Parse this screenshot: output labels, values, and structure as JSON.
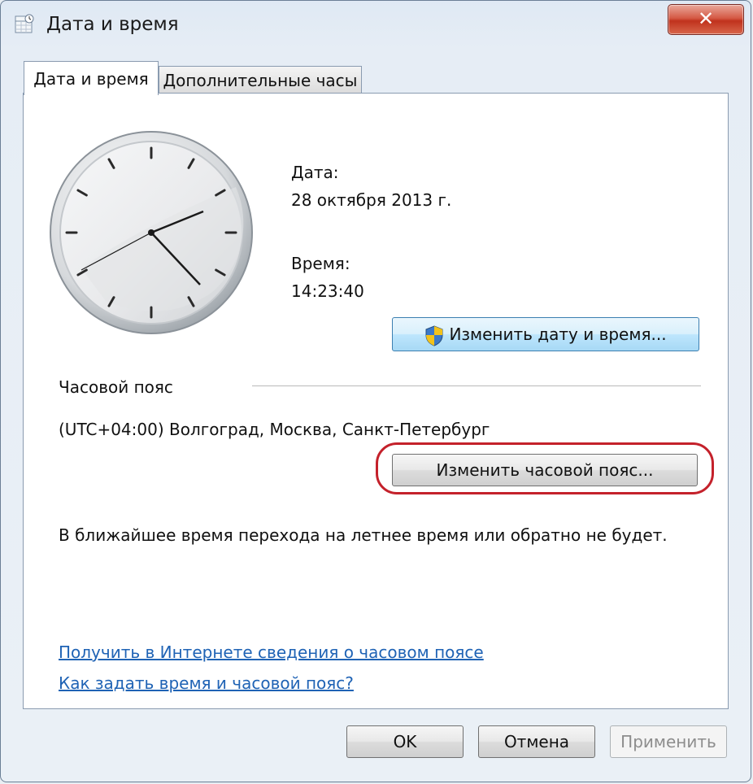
{
  "window": {
    "title": "Дата и время",
    "close_label": "✕"
  },
  "tabs": [
    {
      "label": "Дата и время",
      "active": true
    },
    {
      "label": "Дополнительные часы",
      "active": false
    }
  ],
  "date": {
    "label": "Дата:",
    "value": "28 октября 2013 г."
  },
  "time": {
    "label": "Время:",
    "value": "14:23:40"
  },
  "change_datetime_button": "Изменить дату и время...",
  "timezone": {
    "section_label": "Часовой пояс",
    "value": "(UTC+04:00) Волгоград, Москва, Санкт-Петербург",
    "change_button": "Изменить часовой пояс..."
  },
  "dst_note": "В ближайшее время перехода на летнее время или обратно не будет.",
  "links": {
    "online_info": "Получить в Интернете сведения о часовом поясе",
    "help": "Как задать время и часовой пояс?"
  },
  "footer": {
    "ok": "OK",
    "cancel": "Отмена",
    "apply": "Применить"
  },
  "colors": {
    "accent_highlight": "#c4212b",
    "link": "#1f63b5"
  },
  "icons": [
    "calendar-clock-icon",
    "close-icon",
    "shield-uac-icon",
    "analog-clock"
  ]
}
